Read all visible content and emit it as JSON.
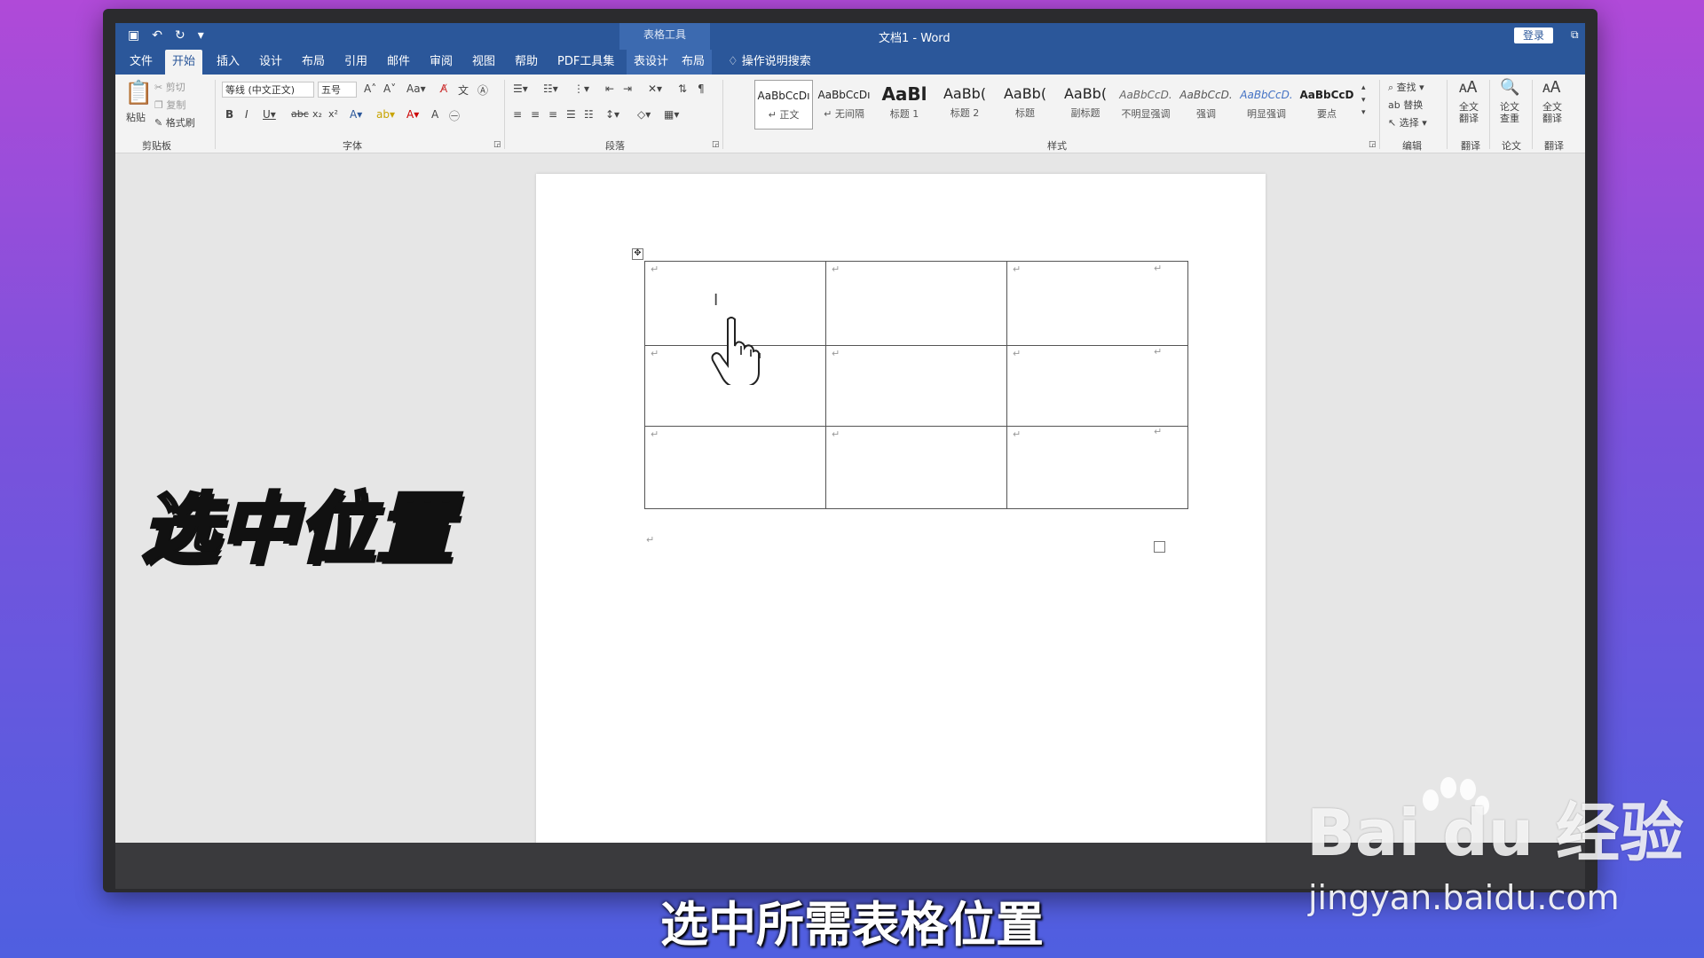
{
  "titlebar": {
    "context_title": "表格工具",
    "doc_title": "文档1  -  Word",
    "login": "登录"
  },
  "tabs": [
    "文件",
    "开始",
    "插入",
    "设计",
    "布局",
    "引用",
    "邮件",
    "审阅",
    "视图",
    "帮助",
    "PDF工具集",
    "表设计",
    "布局"
  ],
  "active_tab": "开始",
  "tellme": "操作说明搜索",
  "ribbon": {
    "clipboard": {
      "paste": "粘贴",
      "cut": "剪切",
      "copy": "复制",
      "format_painter": "格式刷",
      "label": "剪贴板"
    },
    "font": {
      "font_name": "等线 (中文正文)",
      "font_size": "五号",
      "label": "字体"
    },
    "paragraph": {
      "label": "段落"
    },
    "styles": {
      "label": "样式",
      "items": [
        {
          "sample": "AaBbCcDı",
          "name": "↵ 正文"
        },
        {
          "sample": "AaBbCcDı",
          "name": "↵ 无间隔"
        },
        {
          "sample": "AaBl",
          "name": "标题 1"
        },
        {
          "sample": "AaBb(",
          "name": "标题 2"
        },
        {
          "sample": "AaBb(",
          "name": "标题"
        },
        {
          "sample": "AaBb(",
          "name": "副标题"
        },
        {
          "sample": "AaBbCcD.",
          "name": "不明显强调"
        },
        {
          "sample": "AaBbCcD.",
          "name": "强调"
        },
        {
          "sample": "AaBbCcD.",
          "name": "明显强调"
        },
        {
          "sample": "AaBbCcD",
          "name": "要点"
        }
      ]
    },
    "editing": {
      "find": "查找",
      "replace": "替换",
      "select": "选择",
      "label": "编辑"
    },
    "translate1": {
      "line1": "全文",
      "line2": "翻译",
      "label": "翻译"
    },
    "paper": {
      "line1": "论文",
      "line2": "查重",
      "label": "论文"
    },
    "translate2": {
      "line1": "全文",
      "line2": "翻译",
      "label": "翻译"
    }
  },
  "paragraph_mark": "↵",
  "overlay": {
    "caption": "选中位置",
    "subtitle": "选中所需表格位置",
    "watermark_logo": "Bai du 经验",
    "watermark_url": "jingyan.baidu.com"
  },
  "colors": {
    "word_blue": "#2b579a",
    "ribbon_bg": "#f3f3f3"
  }
}
